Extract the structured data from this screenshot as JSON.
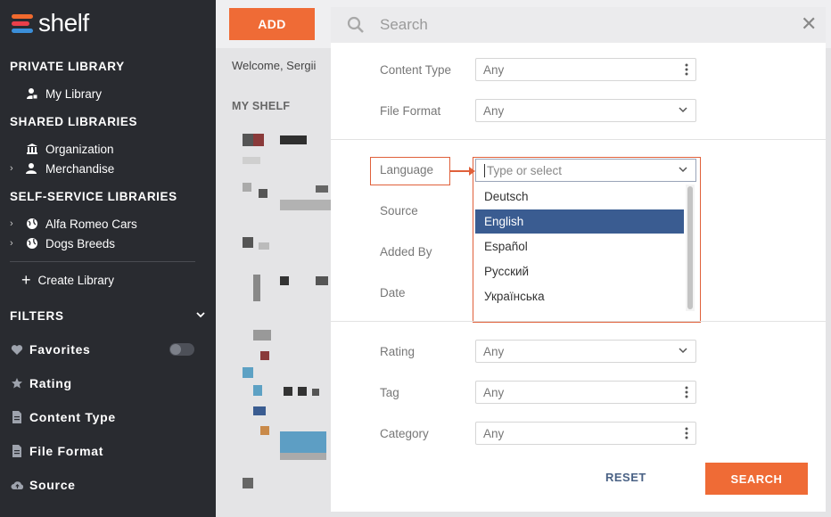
{
  "sidebar": {
    "logo_text": "shelf",
    "private_title": "PRIVATE LIBRARY",
    "my_library": "My Library",
    "shared_title": "SHARED LIBRARIES",
    "organization": "Organization",
    "merchandise": "Merchandise",
    "self_service_title": "SELF-SERVICE LIBRARIES",
    "alfa_romeo": "Alfa Romeo Cars",
    "dogs_breeds": "Dogs Breeds",
    "create_library": "Create Library",
    "filters_title": "FILTERS",
    "filters": {
      "favorites": "Favorites",
      "rating": "Rating",
      "content_type": "Content Type",
      "file_format": "File Format",
      "source": "Source"
    },
    "favorites_toggle_on": false
  },
  "main": {
    "add_button": "ADD",
    "welcome": "Welcome, Sergii",
    "my_shelf": "MY SHELF"
  },
  "search_panel": {
    "placeholder": "Search",
    "fields": {
      "content_type": {
        "label": "Content Type",
        "value": "Any"
      },
      "file_format": {
        "label": "File Format",
        "value": "Any"
      },
      "language": {
        "label": "Language",
        "placeholder": "Type or select"
      },
      "source": {
        "label": "Source"
      },
      "added_by": {
        "label": "Added By"
      },
      "date": {
        "label": "Date"
      },
      "rating": {
        "label": "Rating",
        "value": "Any"
      },
      "tag": {
        "label": "Tag",
        "value": "Any"
      },
      "category": {
        "label": "Category",
        "value": "Any"
      }
    },
    "language_options": [
      "Deutsch",
      "English",
      "Español",
      "Русский",
      "Українська"
    ],
    "selected_language": "English",
    "reset_button": "RESET",
    "search_button": "SEARCH"
  },
  "colors": {
    "accent": "#ef6b36",
    "sidebar_bg": "#292b30",
    "selected_option": "#3a5c91",
    "highlight_annotation": "#e0603a"
  }
}
